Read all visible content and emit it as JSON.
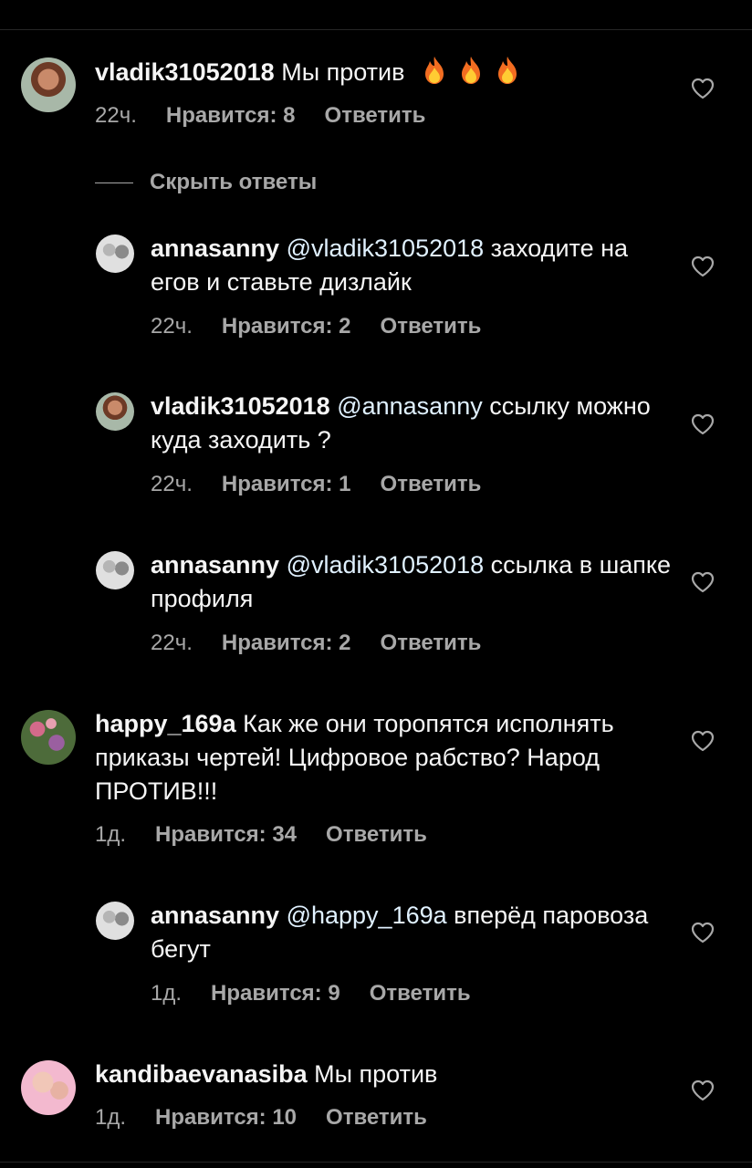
{
  "comments": [
    {
      "username": "vladik31052018",
      "mention": "",
      "text": "Мы против",
      "emoji": "fire",
      "time": "22ч.",
      "likes": "Нравится: 8",
      "reply_label": "Ответить"
    },
    {
      "username": "annasanny",
      "mention": "@vladik31052018",
      "text": "заходите на егов и ставьте дизлайк",
      "time": "22ч.",
      "likes": "Нравится: 2",
      "reply_label": "Ответить"
    },
    {
      "username": "vladik31052018",
      "mention": "@annasanny",
      "text": "ссылку можно куда заходить ?",
      "time": "22ч.",
      "likes": "Нравится: 1",
      "reply_label": "Ответить"
    },
    {
      "username": "annasanny",
      "mention": "@vladik31052018",
      "text": "ссылка в шапке профиля",
      "time": "22ч.",
      "likes": "Нравится: 2",
      "reply_label": "Ответить"
    },
    {
      "username": "happy_169a",
      "mention": "",
      "text": "Как же они торопятся исполнять приказы чертей! Цифровое рабство? Народ ПРОТИВ!!!",
      "time": "1д.",
      "likes": "Нравится: 34",
      "reply_label": "Ответить"
    },
    {
      "username": "annasanny",
      "mention": "@happy_169a",
      "text": "вперёд паровоза бегут",
      "time": "1д.",
      "likes": "Нравится: 9",
      "reply_label": "Ответить"
    },
    {
      "username": "kandibaevanasiba",
      "mention": "",
      "text": "Мы против",
      "time": "1д.",
      "likes": "Нравится: 10",
      "reply_label": "Ответить"
    }
  ],
  "hide_replies_label": "Скрыть ответы",
  "icons": {
    "like": "heart-outline-icon",
    "fire": "fire-emoji-icon"
  },
  "colors": {
    "background": "#000000",
    "text": "#f5f5f5",
    "secondary": "#a8a8a8",
    "mention": "#e0f1ff"
  }
}
